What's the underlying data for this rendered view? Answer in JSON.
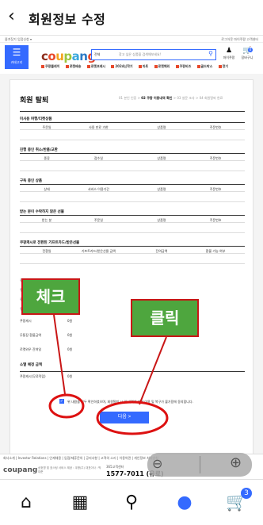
{
  "appbar": {
    "title": "회원정보 수정",
    "back_icon": "chevron-left-icon"
  },
  "site": {
    "topline_left": "즐겨찾기   입점신청 ▾",
    "topline_right": "로그아웃   마이쿠팡   고객센터",
    "menu_label": "카테고리",
    "logo_letters": [
      "c",
      "o",
      "u",
      "p",
      "a",
      "n",
      "g"
    ],
    "search_category": "전체",
    "search_placeholder": "찾고 싶은 상품을 검색해보세요!",
    "header_icons": [
      {
        "name": "마이쿠팡"
      },
      {
        "name": "장바구니"
      }
    ],
    "cart_count": "0",
    "categories": [
      "쿠팡플레이",
      "로켓배송",
      "로켓프레시",
      "2024신학기",
      "마트",
      "로켓해외",
      "쿠팡비즈",
      "골드박스",
      "정기"
    ]
  },
  "page": {
    "title": "회원 탈퇴",
    "steps": [
      "01 본인 인증",
      "02 쿠팡 이용내역 확인",
      "03 설문 조사",
      "04 회원탈퇴 완료"
    ],
    "current_step": 1,
    "sections": [
      {
        "title": "미사용 여행/티켓상품",
        "cols": [
          "주문일",
          "사용 만료 기한",
          "상품명",
          "주문번호"
        ]
      },
      {
        "title": "진행 중인 취소/반품/교환",
        "cols": [
          "종류",
          "접수일",
          "상품명",
          "주문번호"
        ]
      },
      {
        "title": "구독 중인 상품",
        "cols": [
          "상태",
          "서비스 이용기간",
          "상품명",
          "주문번호"
        ]
      },
      {
        "title": "받는 분이 수락하지 않은 선물",
        "cols": [
          "받는 분",
          "주문일",
          "상품명",
          "주문번호"
        ]
      },
      {
        "title": "쿠팡캐시로 전환된 기프트카드/받은선물",
        "cols": [
          "전환일",
          "기프트카드/받은선물 금액",
          "잔여금액",
          "환불 가능 여부"
        ]
      }
    ],
    "amount_rows": [
      {
        "label": "쿠팡캐시",
        "value": "0원"
      },
      {
        "label": "쿠팡캐시(유상)",
        "value": "0원"
      },
      {
        "label": "쿠팡캐시(무상)",
        "value": "0원"
      },
      {
        "label": "쿠팡포인트",
        "value": "0원"
      },
      {
        "label": "쿠팡캐시",
        "value": "0원"
      },
      {
        "label": "무통장 환불금액",
        "value": "0원"
      },
      {
        "label": "로켓와우 잔여일",
        "value": "0원"
      }
    ],
    "expiring_title": "소멸 예정 금액",
    "expiring_row": {
      "label": "쿠팡캐시(무료적립)",
      "value": "0원"
    },
    "agree_text": "위 내용을 모두 확인하였으며, 회원탈퇴 시 위 내역에 대한 이용 및 복구가 불가함에 동의합니다.",
    "next_button": "다음 >"
  },
  "footer": {
    "links": "회사소개 | Investor Relations | 인재채용 | 입점/제휴문의 | 공지사항 | 고객의 소리 | 이용약관 | 개인정보 처리방침",
    "logo": "coupang",
    "company": "상호명 및 호스팅 서비스 제공 : 쿠팡(주) 대표이사 : 박대준",
    "cs_label": "365고객센터",
    "phone": "1577-7011 (유료)"
  },
  "zoom": {
    "minus_icon": "zoom-out-icon",
    "plus_icon": "zoom-in-icon"
  },
  "annotations": [
    {
      "text": "체크",
      "color": "#4ea63e"
    },
    {
      "text": "클릭",
      "color": "#4ea63e"
    }
  ],
  "bottom_nav": [
    {
      "name": "home-icon"
    },
    {
      "name": "category-grid-icon"
    },
    {
      "name": "search-icon"
    },
    {
      "name": "profile-icon"
    },
    {
      "name": "cart-icon"
    }
  ],
  "nav_cart_badge": "3",
  "accent": "#346aff"
}
